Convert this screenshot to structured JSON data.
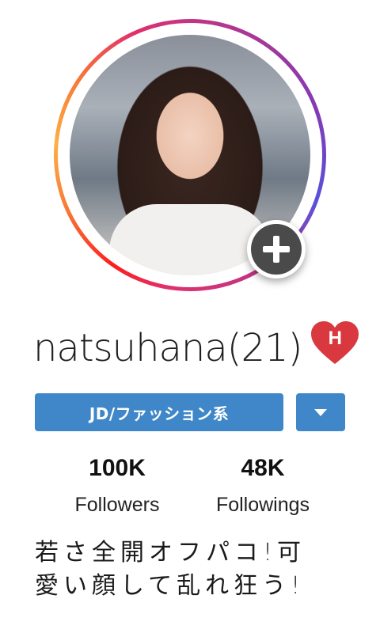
{
  "profile": {
    "username": "natsuhana(21)",
    "badge_letter": "H",
    "badge_color": "#d9383f",
    "ring_colors": [
      "#fcaf45",
      "#f77737",
      "#fd1d1d",
      "#e1306c",
      "#c13584",
      "#833ab4",
      "#5851db"
    ],
    "avatar_icon": "profile-photo",
    "add_icon": "plus-icon"
  },
  "actions": {
    "tag_label": "JD/ファッション系",
    "dropdown_icon": "caret-down-icon",
    "button_color": "#3f87c8"
  },
  "stats": [
    {
      "value": "100K",
      "label": "Followers"
    },
    {
      "value": "48K",
      "label": "Followings"
    }
  ],
  "bio": {
    "line1": "若さ全開オフパコ!可",
    "line2": "愛い顔して乱れ狂う!"
  }
}
